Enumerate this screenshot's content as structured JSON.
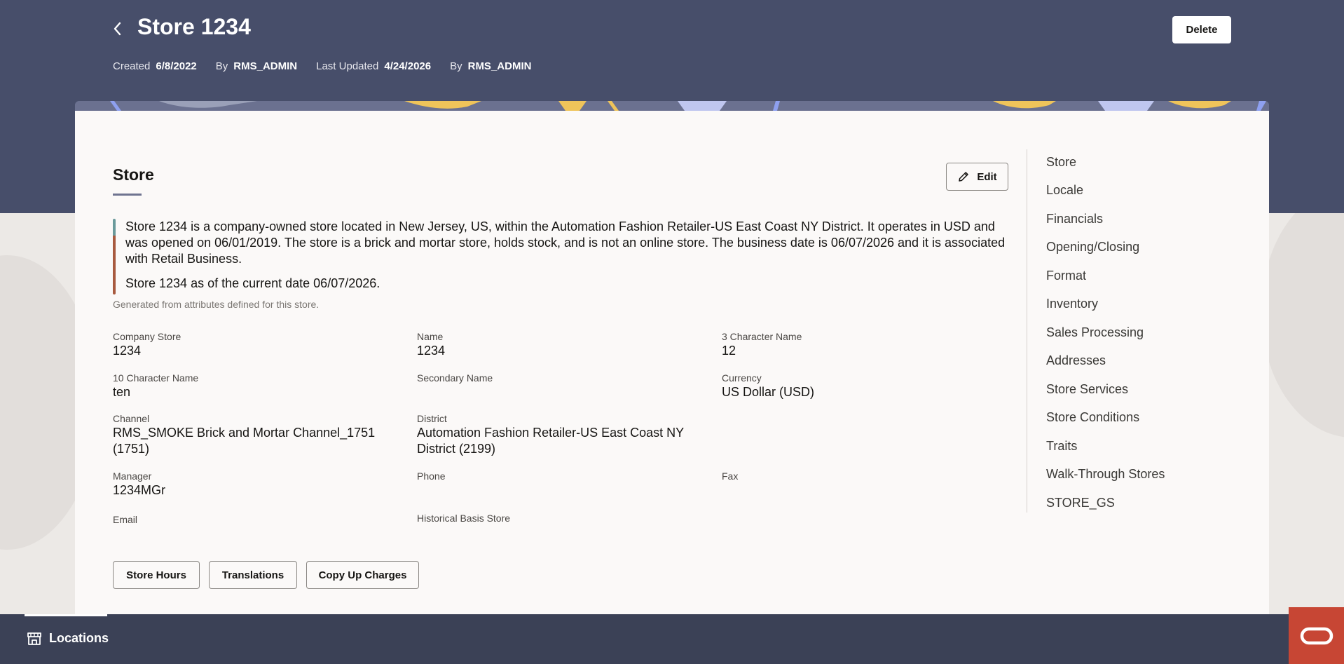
{
  "header": {
    "title": "Store 1234",
    "delete_label": "Delete",
    "meta": {
      "created_label": "Created",
      "created_value": "6/8/2022",
      "created_by_label": "By",
      "created_by_value": "RMS_ADMIN",
      "updated_label": "Last Updated",
      "updated_value": "4/24/2026",
      "updated_by_label": "By",
      "updated_by_value": "RMS_ADMIN"
    }
  },
  "section": {
    "title": "Store",
    "edit_label": "Edit",
    "summary_p1": "Store 1234 is a company-owned store located in New Jersey, US, within the Automation Fashion Retailer-US East Coast NY District. It operates in USD and was opened on 06/01/2019. The store is a brick and mortar store, holds stock, and is not an online store. The business date is 06/07/2026 and it is associated with Retail Business.",
    "summary_p2": "Store 1234 as of the current date 06/07/2026.",
    "generated_note": "Generated from attributes defined for this store."
  },
  "fields": {
    "company_store": {
      "label": "Company Store",
      "value": "1234"
    },
    "name": {
      "label": "Name",
      "value": "1234"
    },
    "three_char_name": {
      "label": "3 Character Name",
      "value": "12"
    },
    "ten_char_name": {
      "label": "10 Character Name",
      "value": "ten"
    },
    "secondary_name": {
      "label": "Secondary Name",
      "value": ""
    },
    "currency": {
      "label": "Currency",
      "value": "US Dollar (USD)"
    },
    "channel": {
      "label": "Channel",
      "value": "RMS_SMOKE Brick and Mortar Channel_1751 (1751)"
    },
    "district": {
      "label": "District",
      "value": "Automation Fashion Retailer-US East Coast NY District (2199)"
    },
    "manager": {
      "label": "Manager",
      "value": "1234MGr"
    },
    "phone": {
      "label": "Phone",
      "value": ""
    },
    "fax": {
      "label": "Fax",
      "value": ""
    },
    "email": {
      "label": "Email",
      "value": ""
    },
    "historical_basis_store": {
      "label": "Historical Basis Store",
      "value": ""
    }
  },
  "actions": {
    "store_hours": "Store Hours",
    "translations": "Translations",
    "copy_up_charges": "Copy Up Charges"
  },
  "nav": {
    "items": [
      "Store",
      "Locale",
      "Financials",
      "Opening/Closing",
      "Format",
      "Inventory",
      "Sales Processing",
      "Addresses",
      "Store Services",
      "Store Conditions",
      "Traits",
      "Walk-Through Stores",
      "STORE_GS"
    ]
  },
  "footer": {
    "tab_label": "Locations",
    "tab_icon": "store-icon",
    "brand_icon": "oracle-logo-icon"
  },
  "colors": {
    "header_bg": "#474e6a",
    "footer_bg": "#3b4156",
    "oracle_red": "#c74634",
    "card_bg": "#fbf9f8"
  }
}
